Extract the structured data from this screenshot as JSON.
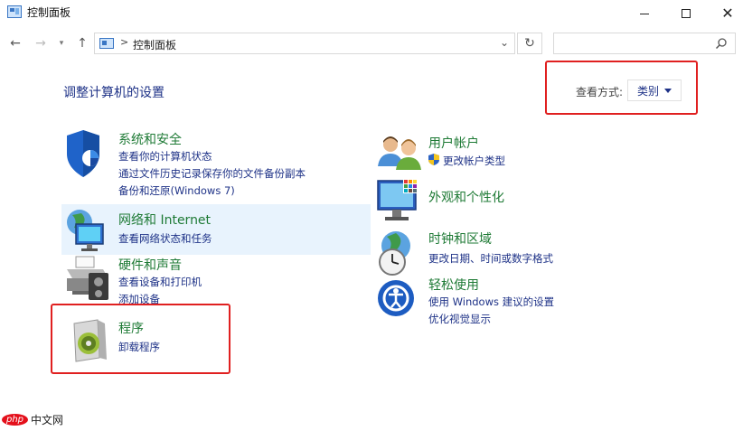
{
  "window": {
    "title": "控制面板"
  },
  "address_bar": {
    "path_label": "控制面板",
    "separator": ">",
    "search_placeholder": ""
  },
  "main": {
    "heading": "调整计算机的设置",
    "view_by_label": "查看方式:",
    "view_by_value": "类别"
  },
  "categories": {
    "system": {
      "title": "系统和安全",
      "links": [
        "查看你的计算机状态",
        "通过文件历史记录保存你的文件备份副本",
        "备份和还原(Windows 7)"
      ]
    },
    "network": {
      "title": "网络和 Internet",
      "links": [
        "查看网络状态和任务"
      ]
    },
    "hardware": {
      "title": "硬件和声音",
      "links": [
        "查看设备和打印机",
        "添加设备"
      ]
    },
    "programs": {
      "title": "程序",
      "links": [
        "卸载程序"
      ]
    },
    "user": {
      "title": "用户帐户",
      "links": [
        "更改帐户类型"
      ]
    },
    "appearance": {
      "title": "外观和个性化",
      "links": []
    },
    "clock": {
      "title": "时钟和区域",
      "links": [
        "更改日期、时间或数字格式"
      ]
    },
    "ease": {
      "title": "轻松使用",
      "links": [
        "使用 Windows 建议的设置",
        "优化视觉显示"
      ]
    }
  },
  "watermark": {
    "logo": "php",
    "text": "中文网"
  },
  "colors": {
    "link": "#1e3287",
    "category_title": "#1e7a35",
    "highlight_box": "#e02020",
    "hover_bg": "#e8f3fd"
  }
}
